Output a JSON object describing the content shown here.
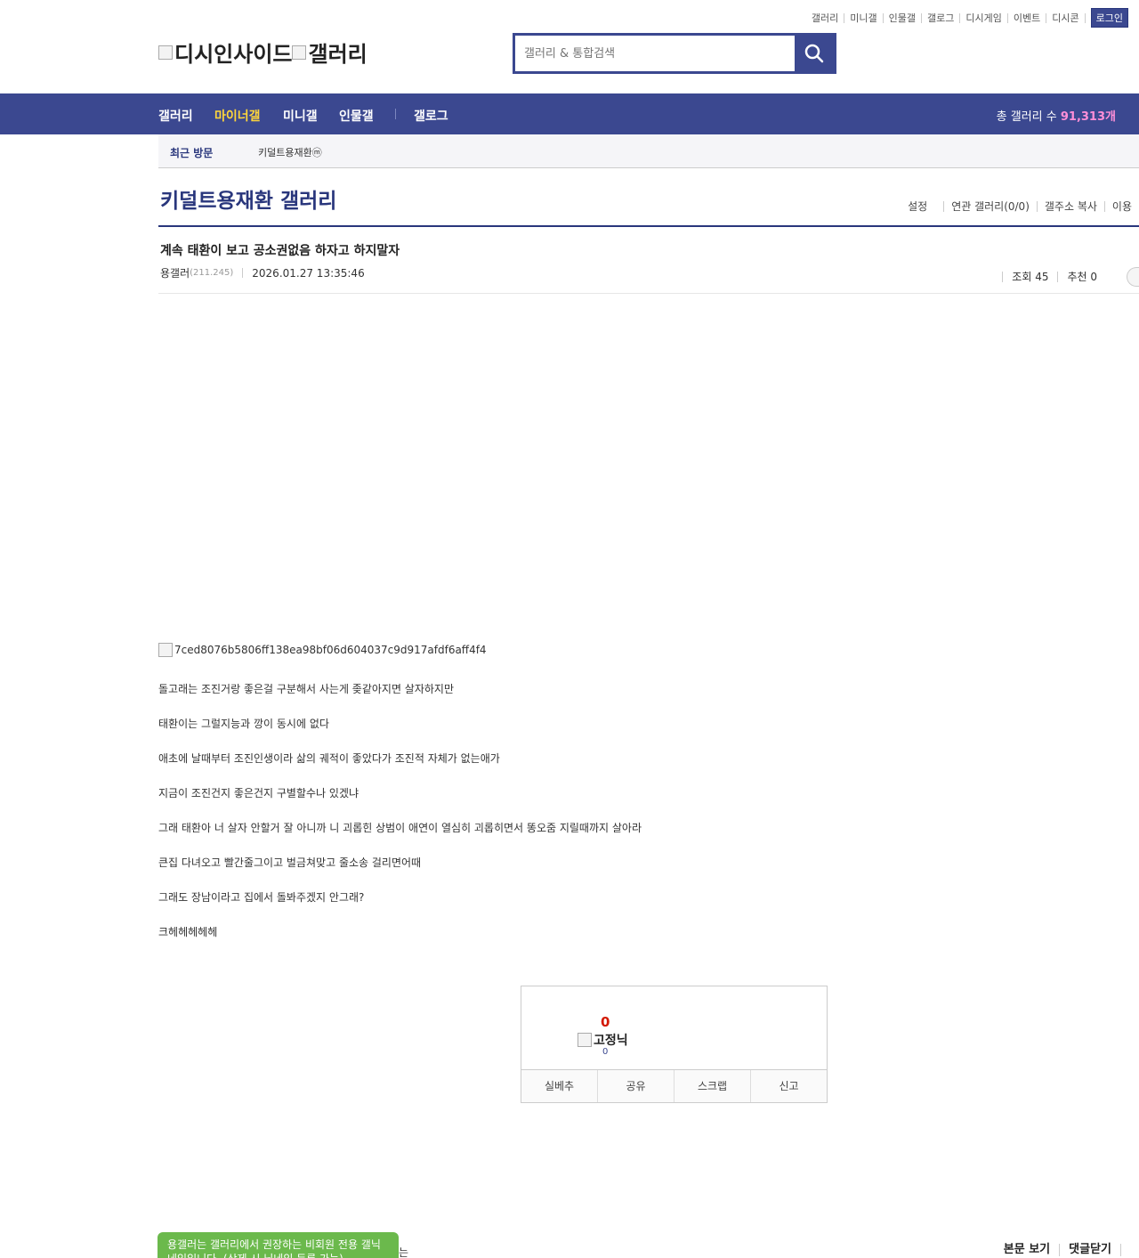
{
  "top_links": [
    "갤러리",
    "미니갤",
    "인물갤",
    "갤로그",
    "디시게임",
    "이벤트",
    "디시콘"
  ],
  "login_label": "로그인",
  "logo": {
    "part1": "디시인사이드",
    "part2": "갤러리"
  },
  "search": {
    "placeholder": "갤러리 & 통합검색"
  },
  "nav": {
    "items": [
      "갤러리",
      "마이너갤",
      "미니갤",
      "인물갤",
      "갤로그"
    ],
    "active": "마이너갤",
    "count_label": "총 갤러리 수",
    "count_value": "91,313개"
  },
  "recent": {
    "label": "최근 방문",
    "item": "키덜트용재환ⓜ"
  },
  "gallery": {
    "title": "키덜트용재환 갤러리",
    "tools": [
      "설정",
      "연관 갤러리(0/0)",
      "갤주소 복사",
      "이용"
    ]
  },
  "post": {
    "title": "계속 태환이 보고 공소권없음 하자고 하지말자",
    "author": "용갤러",
    "ip": "(211.245)",
    "date": "2026.01.27 13:35:46",
    "views_label": "조회 45",
    "recommend_label": "추천 0",
    "image_alt": "7ced8076b5806ff138ea98bf06d604037c9d917afdf6aff4f4",
    "lines": [
      "돌고래는 조진거랑 좋은걸 구분해서 사는게 좆같아지면 살자하지만",
      "태환이는 그럴지능과 깡이 동시에 없다",
      "애초에 날때부터 조진인생이라 삶의 궤적이 좋았다가 조진적 자체가 없는애가",
      "지금이 조진건지 좋은건지 구별할수나 있겠냐",
      "그래 태환아 너 살자 안할거 잘 아니까 니 괴롭힌 상범이 애연이 열심히 괴롭히면서 똥오줌 지릴때까지 살아라",
      "큰집 다녀오고 빨간줄그이고 벌금쳐맞고 줄소송 걸리면어때",
      "그래도 장남이라고 집에서 돌봐주겠지 안그래?",
      "크헤헤헤헤헤"
    ]
  },
  "recommend_box": {
    "count": "0",
    "nick_label": "고정닉",
    "nick_count": "0",
    "actions": [
      "실베추",
      "공유",
      "스크랩",
      "신고"
    ]
  },
  "toast": {
    "text": "용갤러는 갤러리에서 권장하는 비회원 전용 갤닉네임입니다. (삭제 시 닉네임 등록 가능)",
    "tail": "는"
  },
  "bottom_links": [
    "본문 보기",
    "댓글닫기"
  ]
}
